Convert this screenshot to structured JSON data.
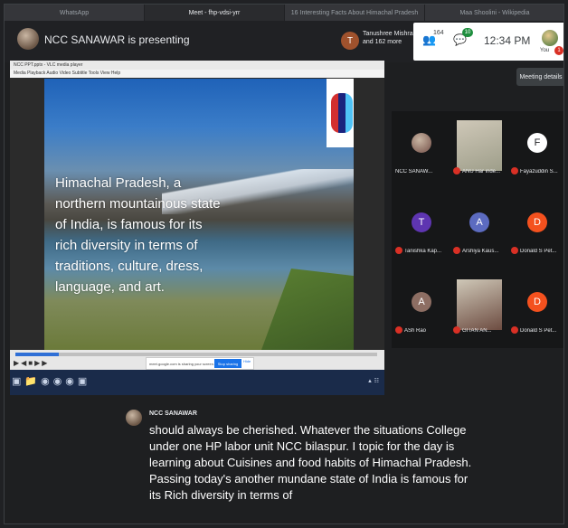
{
  "tabs": [
    {
      "label": "WhatsApp",
      "active": false
    },
    {
      "label": "Meet - fhp-vdsi-yrr",
      "active": true
    },
    {
      "label": "16 Interesting Facts About Himachal Pradesh",
      "active": false
    },
    {
      "label": "Maa Shoolini - Wikipedia",
      "active": false
    }
  ],
  "header": {
    "presenting_label": "NCC SANAWAR is presenting",
    "tile_initial": "T",
    "tile_name": "Tanushree Mishra and 162 more",
    "people_count": "164",
    "chat_badge": "10",
    "time": "12:34 PM",
    "you_label": "You",
    "notification_count": "1",
    "meeting_details": "Meeting details"
  },
  "shared_window": {
    "title": "NCC PPT.pptx - VLC media player",
    "menu": "Media  Playback  Audio  Video  Subtitle  Tools  View  Help",
    "slide_text": "Himachal Pradesh, a northern mountainous state of India, is famous for its rich diversity in terms of traditions, culture, dress, language, and art.",
    "progress": 0.12,
    "share_notice": "meet.google.com is sharing your screen.",
    "stop_sharing": "Stop sharing",
    "hide": "Hide"
  },
  "participants": [
    {
      "name": "NCC SANAW...",
      "initial": "",
      "color": "#8d6e63",
      "muted": false,
      "type": "photo"
    },
    {
      "name": "ANU Har inde...",
      "initial": "",
      "color": "#9e9e8a",
      "muted": true,
      "type": "video"
    },
    {
      "name": "Fayazuddin S...",
      "initial": "F",
      "color": "#ffffff",
      "muted": true,
      "type": "initial"
    },
    {
      "name": "Tanishka Kap...",
      "initial": "T",
      "color": "#5e35b1",
      "muted": true,
      "type": "initial"
    },
    {
      "name": "Arshiya Kaus...",
      "initial": "A",
      "color": "#5c6bc0",
      "muted": true,
      "type": "initial"
    },
    {
      "name": "Donald S Pet...",
      "initial": "D",
      "color": "#f4511e",
      "muted": true,
      "type": "initial"
    },
    {
      "name": "ASh Rao",
      "initial": "A",
      "color": "#8d6e63",
      "muted": true,
      "type": "initial"
    },
    {
      "name": "GITAN AN...",
      "initial": "",
      "color": "#6d4c41",
      "muted": true,
      "type": "video"
    },
    {
      "name": "Donald S Pet...",
      "initial": "D",
      "color": "#f4511e",
      "muted": true,
      "type": "initial"
    }
  ],
  "caption": {
    "speaker": "NCC SANAWAR",
    "text": "should always be cherished. Whatever the situations College under one HP labor unit NCC bilaspur. I topic for the day is learning about Cuisines and food habits of Himachal Pradesh. Passing today's another mundane state of India is famous for its Rich diversity in terms of"
  }
}
